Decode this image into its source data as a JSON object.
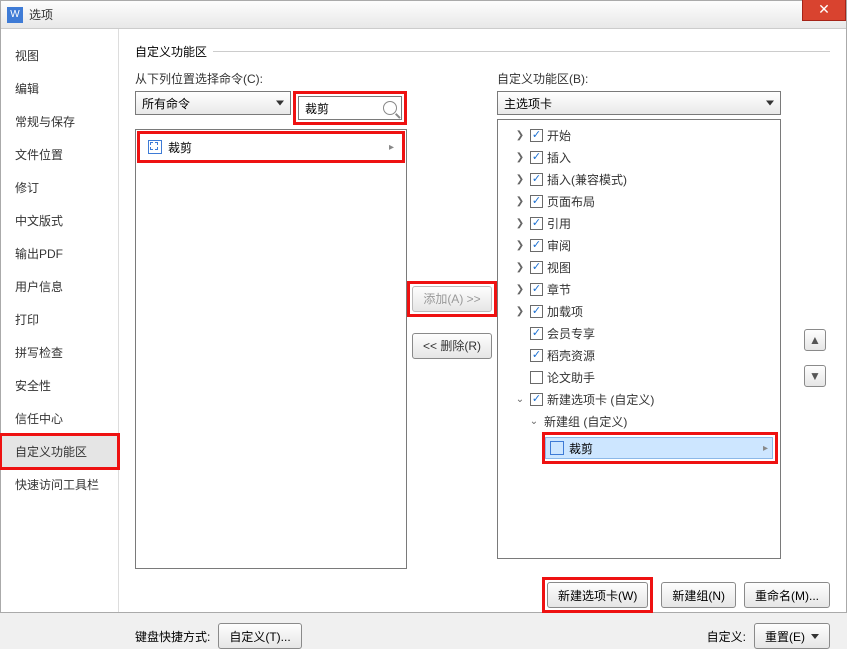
{
  "window": {
    "title": "选项"
  },
  "closeGlyph": "✕",
  "sidebar": {
    "items": [
      {
        "label": "视图"
      },
      {
        "label": "编辑"
      },
      {
        "label": "常规与保存"
      },
      {
        "label": "文件位置"
      },
      {
        "label": "修订"
      },
      {
        "label": "中文版式"
      },
      {
        "label": "输出PDF"
      },
      {
        "label": "用户信息"
      },
      {
        "label": "打印"
      },
      {
        "label": "拼写检查"
      },
      {
        "label": "安全性"
      },
      {
        "label": "信任中心"
      },
      {
        "label": "自定义功能区"
      },
      {
        "label": "快速访问工具栏"
      }
    ],
    "selectedIndex": 12
  },
  "section": {
    "title": "自定义功能区"
  },
  "left": {
    "chooseLabel": "从下列位置选择命令(C):",
    "selectValue": "所有命令",
    "searchValue": "裁剪",
    "resultItem": "裁剪"
  },
  "mid": {
    "addLabel": "添加(A) >>",
    "removeLabel": "<< 删除(R)"
  },
  "right": {
    "ribbonLabel": "自定义功能区(B):",
    "selectValue": "主选项卡",
    "tree": [
      {
        "label": "开始",
        "checked": true,
        "expandable": true
      },
      {
        "label": "插入",
        "checked": true,
        "expandable": true
      },
      {
        "label": "插入(兼容模式)",
        "checked": true,
        "expandable": true
      },
      {
        "label": "页面布局",
        "checked": true,
        "expandable": true
      },
      {
        "label": "引用",
        "checked": true,
        "expandable": true
      },
      {
        "label": "审阅",
        "checked": true,
        "expandable": true
      },
      {
        "label": "视图",
        "checked": true,
        "expandable": true
      },
      {
        "label": "章节",
        "checked": true,
        "expandable": true
      },
      {
        "label": "加载项",
        "checked": true,
        "expandable": true
      },
      {
        "label": "会员专享",
        "checked": true,
        "expandable": false
      },
      {
        "label": "稻壳资源",
        "checked": true,
        "expandable": false
      },
      {
        "label": "论文助手",
        "checked": false,
        "expandable": false
      }
    ],
    "customTab": "新建选项卡 (自定义)",
    "customGroup": "新建组 (自定义)",
    "customCmd": "裁剪"
  },
  "bottomR": {
    "newTab": "新建选项卡(W)",
    "newGroup": "新建组(N)",
    "rename": "重命名(M)..."
  },
  "bottomL": {
    "shortcutLabel": "键盘快捷方式:",
    "customize": "自定义(T)..."
  },
  "bottomR2": {
    "customLabel": "自定义:",
    "reset": "重置(E)"
  },
  "glyph": {
    "collapsed": "❯",
    "expanded": "⌄",
    "up": "▲",
    "down": "▼",
    "right": "▸"
  }
}
